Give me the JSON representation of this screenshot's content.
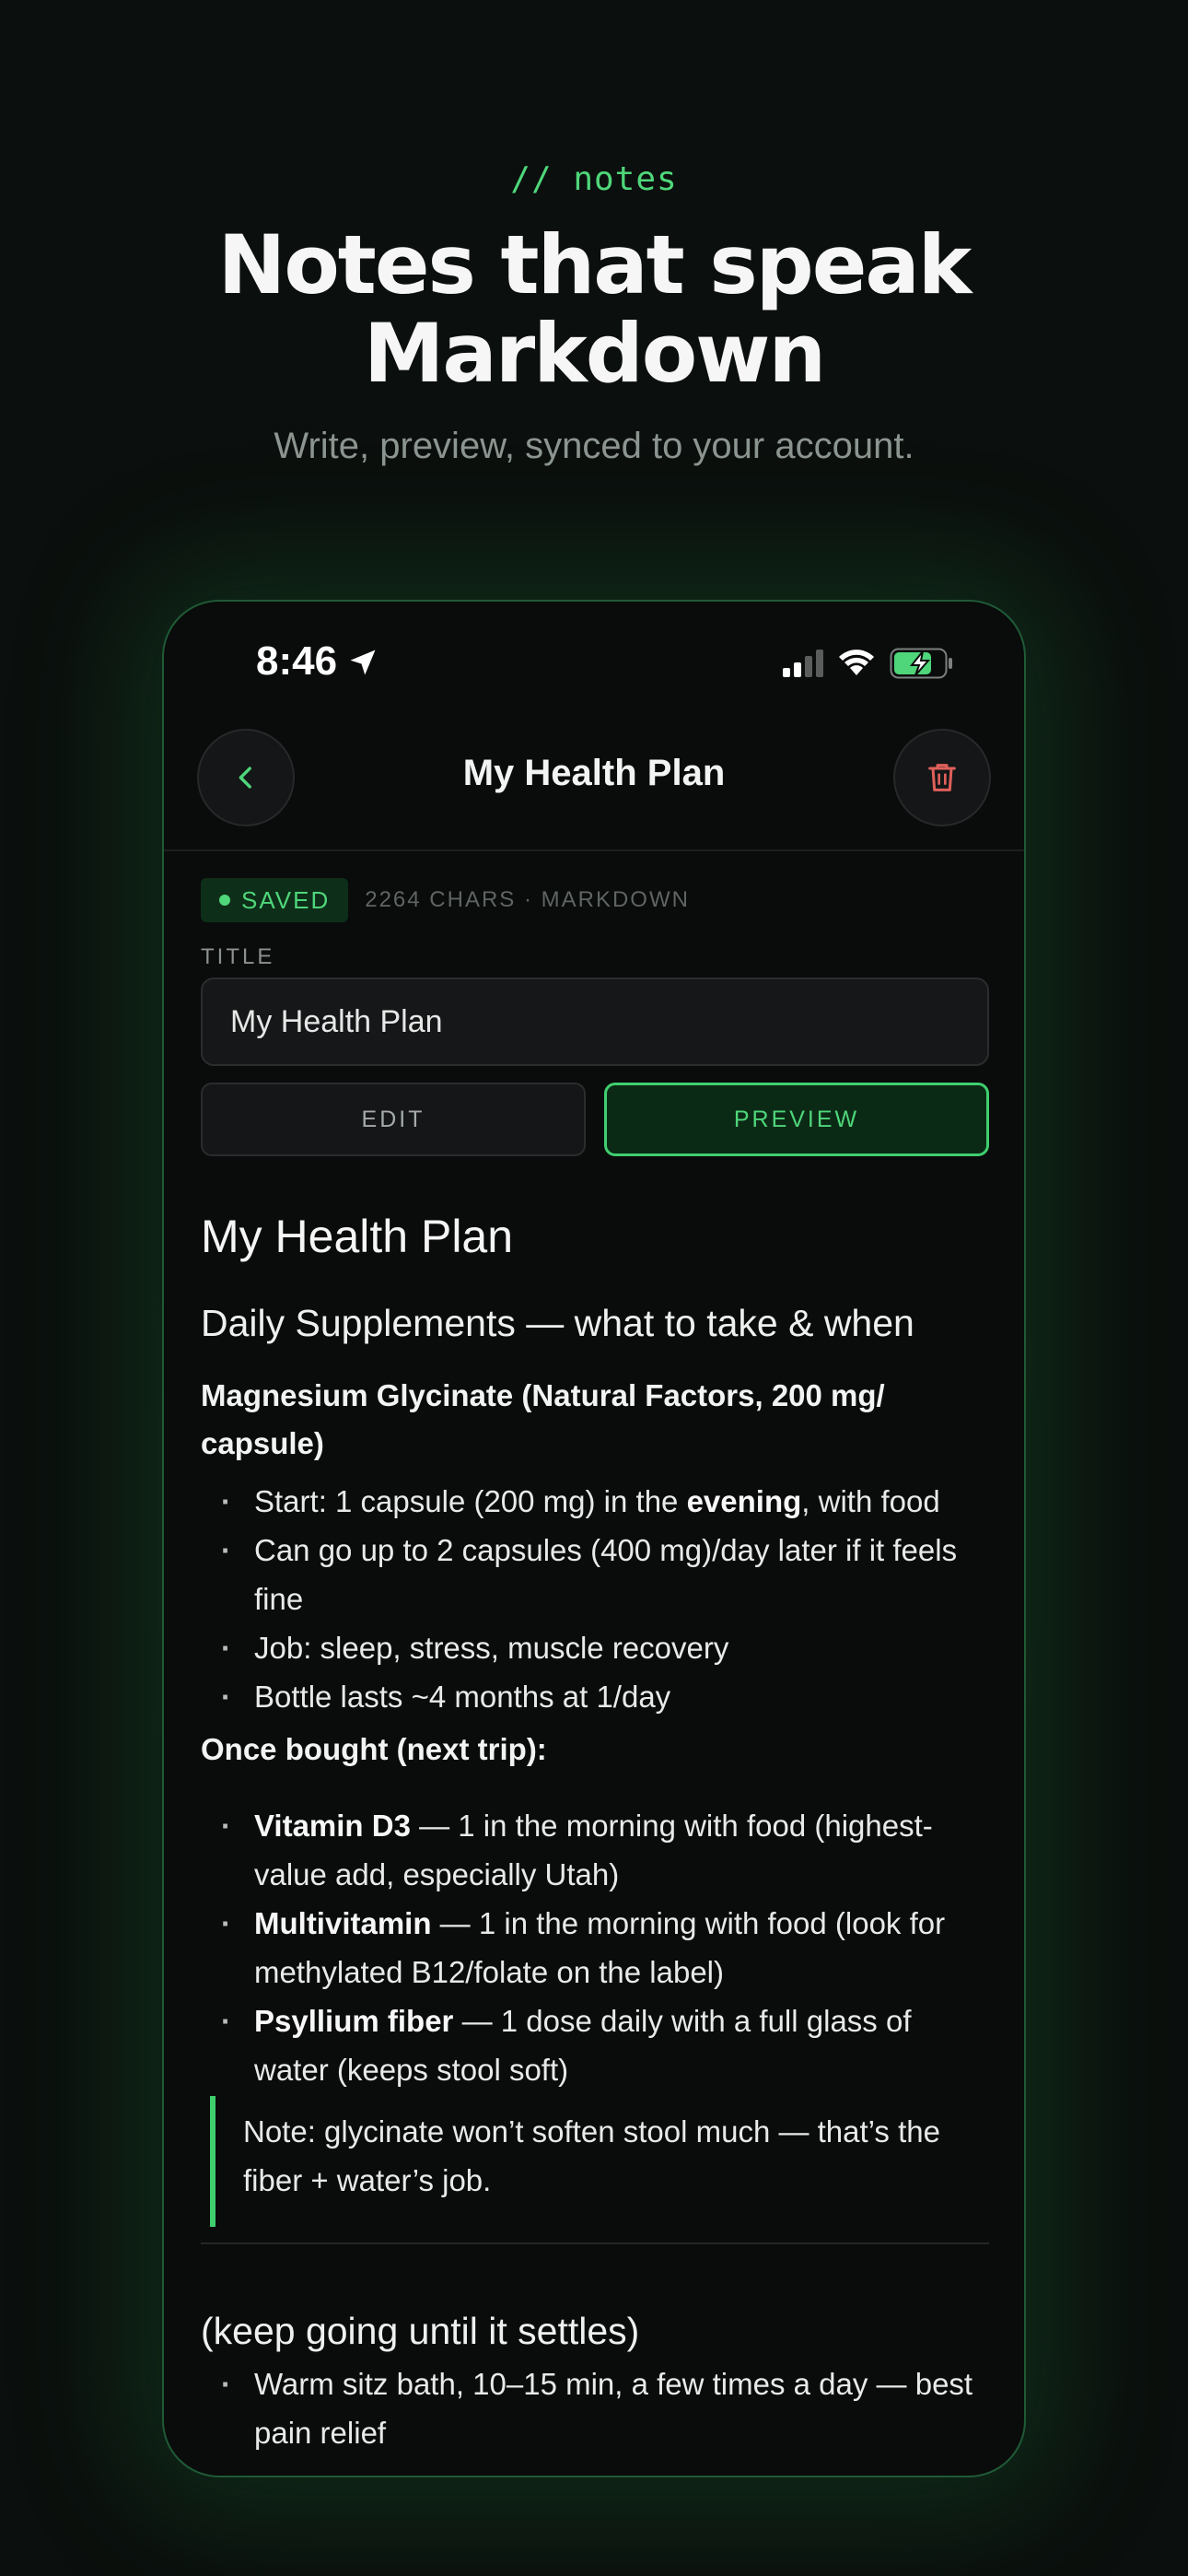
{
  "hero": {
    "eyebrow": "// notes",
    "headline_line1": "Notes that speak",
    "headline_line2": "Markdown",
    "subhead": "Write, preview, synced to your account."
  },
  "status_bar": {
    "time": "8:46",
    "icons": [
      "location-arrow-icon",
      "cellular-signal-icon",
      "wifi-icon",
      "battery-charging-icon"
    ]
  },
  "nav": {
    "title": "My Health Plan",
    "back_icon": "chevron-left-icon",
    "delete_icon": "trash-icon"
  },
  "meta": {
    "saved_label": "SAVED",
    "info": "2264 CHARS · MARKDOWN"
  },
  "title_field": {
    "label": "TITLE",
    "value": "My Health Plan"
  },
  "mode_toggle": {
    "edit_label": "EDIT",
    "preview_label": "PREVIEW",
    "selected": "PREVIEW"
  },
  "preview": {
    "h1": "My Health Plan",
    "h2": "Daily Supplements — what to take & when",
    "section1_title": "Magnesium Glycinate (Natural Factors, 200 mg/ capsule)",
    "section1_items": [
      {
        "pre": "Start: 1 capsule (200 mg) in the ",
        "bold": "evening",
        "post": ", with food"
      },
      {
        "pre": "Can go up to 2 capsules (400 mg)/day later if it feels fine",
        "bold": "",
        "post": ""
      },
      {
        "pre": "Job: sleep, stress, muscle recovery",
        "bold": "",
        "post": ""
      },
      {
        "pre": "Bottle lasts ~4 months at 1/day",
        "bold": "",
        "post": ""
      }
    ],
    "section2_title": "Once bought (next trip):",
    "section2_items": [
      {
        "pre": "",
        "bold": "Vitamin D3",
        "post": " — 1 in the morning with food (highest-value add, especially Utah)"
      },
      {
        "pre": "",
        "bold": "Multivitamin",
        "post": " — 1 in the morning with food (look for methylated B12/folate on the label)"
      },
      {
        "pre": "",
        "bold": "Psyllium fiber",
        "post": " — 1 dose daily with a full glass of water (keeps stool soft)"
      }
    ],
    "note": "Note: glycinate won’t soften stool much — that’s the fiber + water’s job.",
    "h2_second": "(keep going until it settles)",
    "section3_items": [
      {
        "pre": "Warm sitz bath, 10–15 min, a few times a day — best pain relief",
        "bold": "",
        "post": ""
      }
    ]
  },
  "colors": {
    "accent": "#4fd67a",
    "accent_border": "#3fcf6f",
    "background": "#0b0f0d",
    "phone_bg": "#0a0b0b",
    "danger": "#e0605a"
  }
}
